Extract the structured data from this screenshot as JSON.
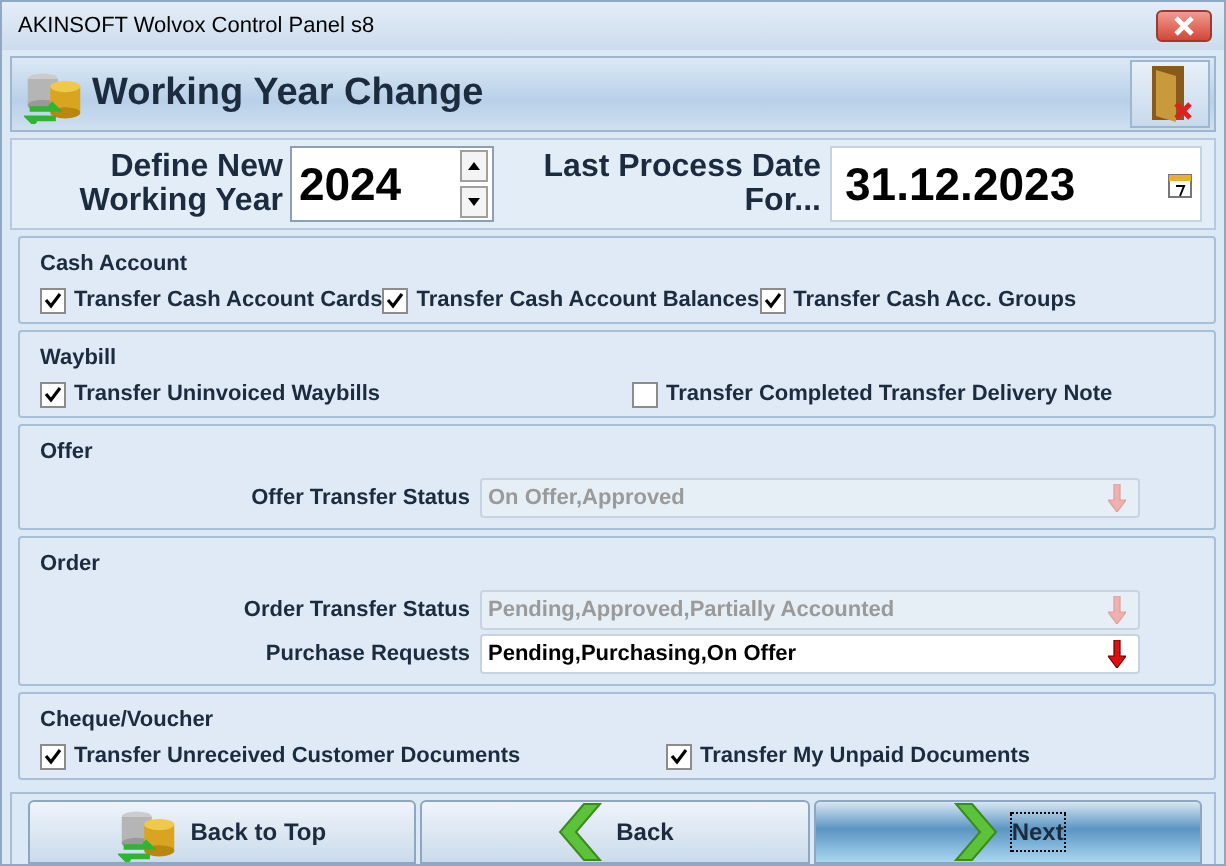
{
  "window": {
    "title": "AKINSOFT Wolvox Control Panel s8"
  },
  "header": {
    "title": "Working Year Change"
  },
  "year": {
    "label": "Define New Working Year",
    "value": "2024"
  },
  "last_date": {
    "label": "Last Process Date For...",
    "value": "31.12.2023"
  },
  "groups": [
    {
      "title": "Cash Account",
      "kind": "checkboxes",
      "items": [
        {
          "label": "Transfer Cash Account Cards",
          "checked": true
        },
        {
          "label": "Transfer Cash Account Balances",
          "checked": true
        },
        {
          "label": "Transfer Cash Acc. Groups",
          "checked": true
        }
      ]
    },
    {
      "title": "Waybill",
      "kind": "checkboxes",
      "items": [
        {
          "label": "Transfer Uninvoiced Waybills",
          "checked": true
        },
        {
          "label": "Transfer Completed Transfer Delivery Note",
          "checked": false
        }
      ]
    },
    {
      "title": "Offer",
      "kind": "selects",
      "items": [
        {
          "label": "Offer Transfer Status",
          "value": "On Offer,Approved",
          "disabled": true
        }
      ]
    },
    {
      "title": "Order",
      "kind": "selects",
      "items": [
        {
          "label": "Order Transfer Status",
          "value": "Pending,Approved,Partially Accounted",
          "disabled": true
        },
        {
          "label": "Purchase Requests",
          "value": "Pending,Purchasing,On Offer",
          "disabled": false
        }
      ]
    },
    {
      "title": "Cheque/Voucher",
      "kind": "checkboxes",
      "items": [
        {
          "label": "Transfer Unreceived Customer Documents",
          "checked": true
        },
        {
          "label": "Transfer My Unpaid Documents",
          "checked": true
        }
      ]
    }
  ],
  "buttons": [
    {
      "label": "Back to Top",
      "kind": "home",
      "focused": false
    },
    {
      "label": "Back",
      "kind": "back",
      "focused": false
    },
    {
      "label": "Next",
      "kind": "next",
      "focused": true
    }
  ]
}
